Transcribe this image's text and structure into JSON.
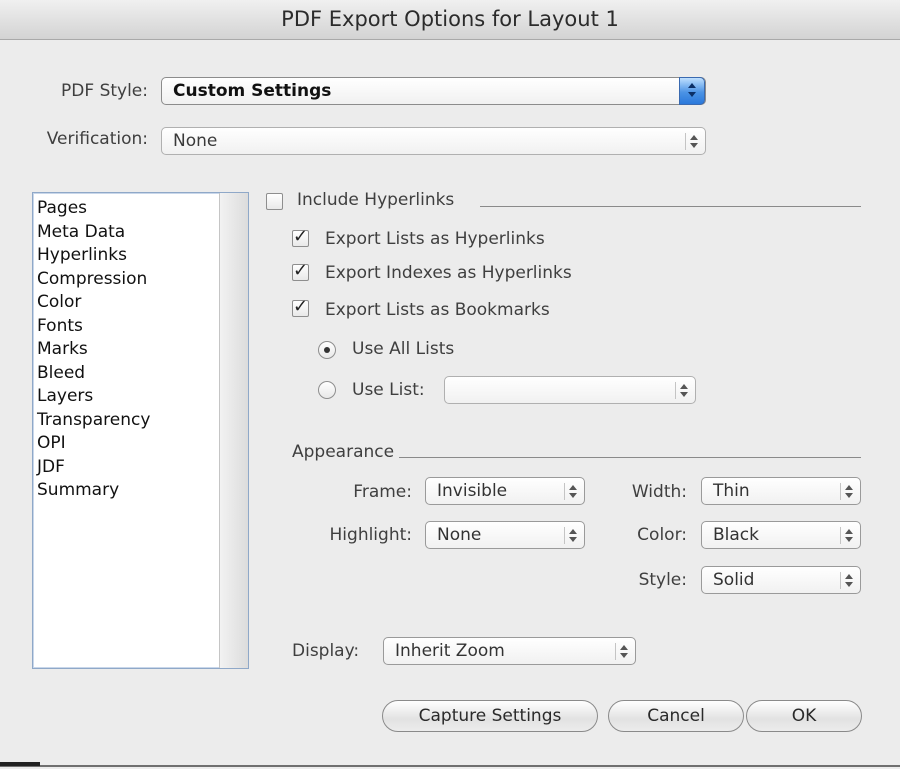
{
  "window": {
    "title": "PDF Export Options for Layout 1"
  },
  "pdf_style": {
    "label": "PDF Style:",
    "value": "Custom Settings"
  },
  "verification": {
    "label": "Verification:",
    "value": "None"
  },
  "sidebar": {
    "items": [
      "Pages",
      "Meta Data",
      "Hyperlinks",
      "Compression",
      "Color",
      "Fonts",
      "Marks",
      "Bleed",
      "Layers",
      "Transparency",
      "OPI",
      "JDF",
      "Summary"
    ]
  },
  "hyperlinks": {
    "include_label": "Include Hyperlinks",
    "include_checked": false,
    "export_lists_label": "Export Lists as Hyperlinks",
    "export_lists_checked": true,
    "export_indexes_label": "Export Indexes as Hyperlinks",
    "export_indexes_checked": true,
    "export_bookmarks_label": "Export Lists as Bookmarks",
    "export_bookmarks_checked": true,
    "use_all_lists_label": "Use All Lists",
    "use_list_label": "Use List:",
    "use_list_value": "",
    "selected_radio": "use-all-lists"
  },
  "appearance": {
    "section_label": "Appearance",
    "frame_label": "Frame:",
    "frame_value": "Invisible",
    "highlight_label": "Highlight:",
    "highlight_value": "None",
    "width_label": "Width:",
    "width_value": "Thin",
    "color_label": "Color:",
    "color_value": "Black",
    "style_label": "Style:",
    "style_value": "Solid"
  },
  "display": {
    "label": "Display:",
    "value": "Inherit Zoom"
  },
  "buttons": {
    "capture": "Capture Settings",
    "cancel": "Cancel",
    "ok": "OK"
  },
  "icons": {
    "checkmark": "✓"
  }
}
